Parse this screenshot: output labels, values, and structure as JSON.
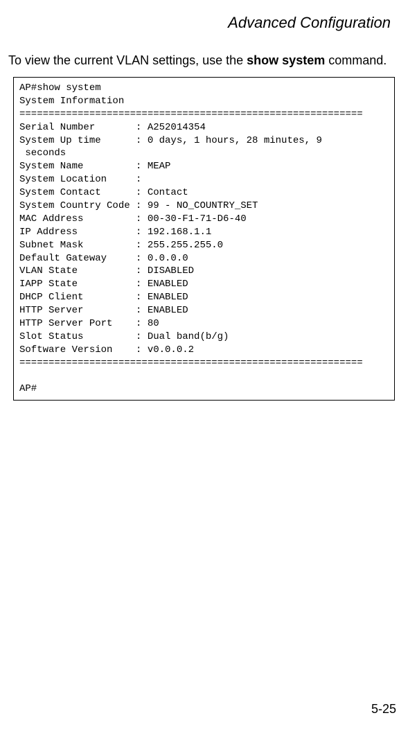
{
  "header": {
    "title": "Advanced Configuration"
  },
  "intro": {
    "prefix": "To view the current VLAN settings, use the ",
    "bold": "show system",
    "suffix": " command."
  },
  "terminal": {
    "line1": "AP#show system",
    "line2": "System Information",
    "line3": "===========================================================",
    "line4": "Serial Number       : A252014354",
    "line5": "System Up time      : 0 days, 1 hours, 28 minutes, 9 ",
    "line6": " seconds",
    "line7": "System Name         : MEAP",
    "line8": "System Location     : ",
    "line9": "System Contact      : Contact",
    "line10": "System Country Code : 99 - NO_COUNTRY_SET",
    "line11": "MAC Address         : 00-30-F1-71-D6-40",
    "line12": "IP Address          : 192.168.1.1",
    "line13": "Subnet Mask         : 255.255.255.0",
    "line14": "Default Gateway     : 0.0.0.0",
    "line15": "VLAN State          : DISABLED",
    "line16": "IAPP State          : ENABLED",
    "line17": "DHCP Client         : ENABLED",
    "line18": "HTTP Server         : ENABLED",
    "line19": "HTTP Server Port    : 80",
    "line20": "Slot Status         : Dual band(b/g)",
    "line21": "Software Version    : v0.0.0.2",
    "line22": "===========================================================",
    "line23": "",
    "line24": "AP#"
  },
  "footer": {
    "page": "5-25"
  }
}
